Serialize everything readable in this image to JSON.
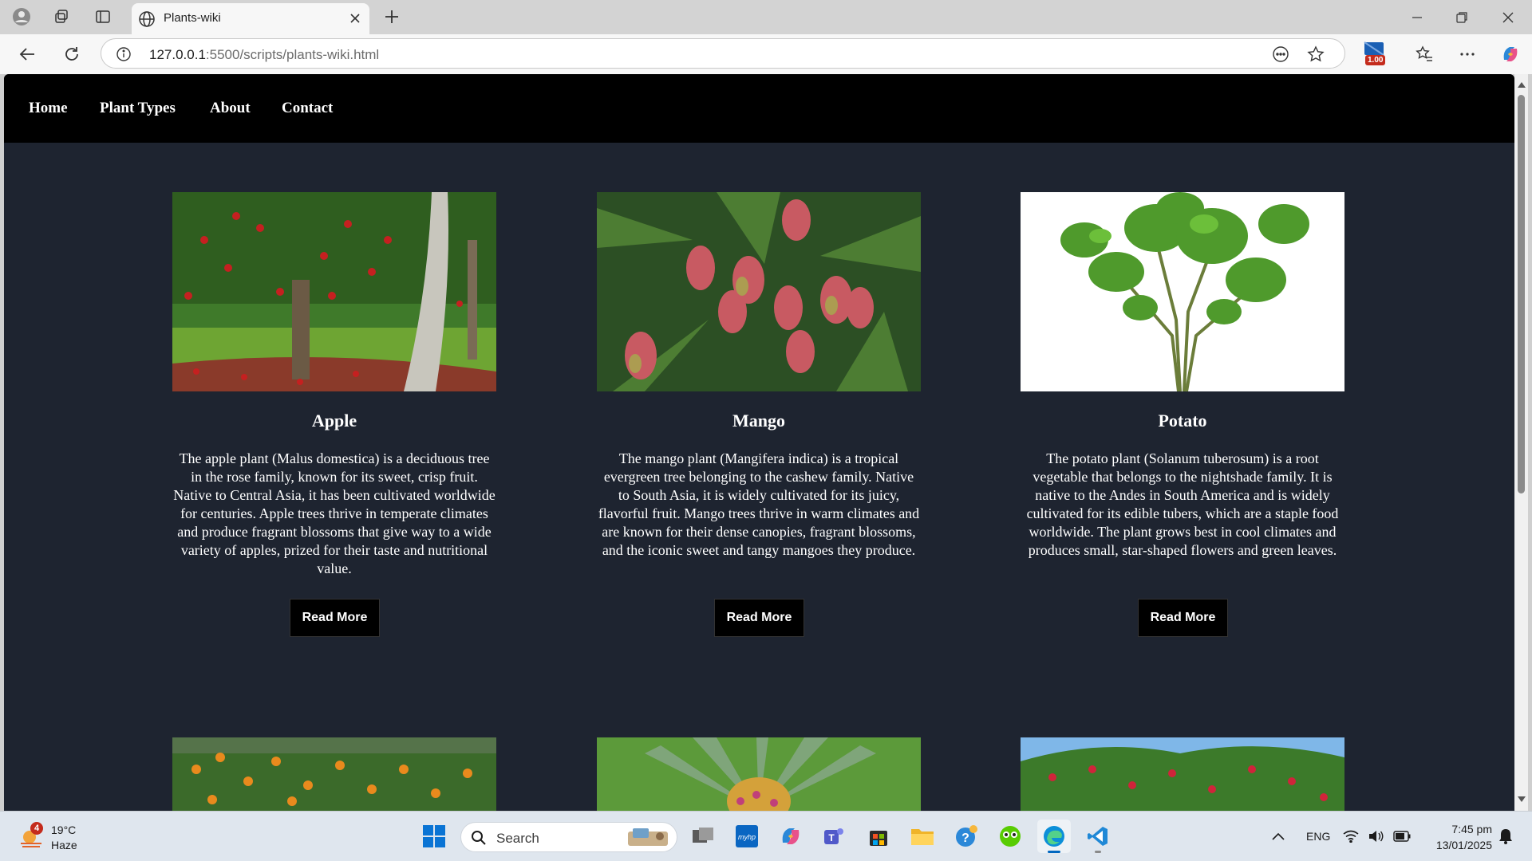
{
  "browser": {
    "tab_title": "Plants-wiki",
    "url_host": "127.0.0.1",
    "url_rest": ":5500/scripts/plants-wiki.html",
    "extension_badge": "1.00"
  },
  "site": {
    "nav": [
      "Home",
      "Plant Types",
      "About",
      "Contact"
    ],
    "cards": [
      {
        "title": "Apple",
        "text": "The apple plant (Malus domestica) is a deciduous tree in the rose family, known for its sweet, crisp fruit. Native to Central Asia, it has been cultivated worldwide for centuries. Apple trees thrive in temperate climates and produce fragrant blossoms that give way to a wide variety of apples, prized for their taste and nutritional value.",
        "button": "Read More"
      },
      {
        "title": "Mango",
        "text": "The mango plant (Mangifera indica) is a tropical evergreen tree belonging to the cashew family. Native to South Asia, it is widely cultivated for its juicy, flavorful fruit. Mango trees thrive in warm climates and are known for their dense canopies, fragrant blossoms, and the iconic sweet and tangy mangoes they produce.",
        "button": "Read More"
      },
      {
        "title": "Potato",
        "text": "The potato plant (Solanum tuberosum) is a root vegetable that belongs to the nightshade family. It is native to the Andes in South America and is widely cultivated for its edible tubers, which are a staple food worldwide. The plant grows best in cool climates and produces small, star-shaped flowers and green leaves.",
        "button": "Read More"
      }
    ]
  },
  "taskbar": {
    "weather_temp": "19°C",
    "weather_cond": "Haze",
    "weather_badge": "4",
    "search_label": "Search",
    "lang": "ENG",
    "time": "7:45 pm",
    "date": "13/01/2025"
  },
  "colors": {
    "page_bg": "#1e2430",
    "nav_bg": "#000000",
    "accent": "#0067c0"
  }
}
